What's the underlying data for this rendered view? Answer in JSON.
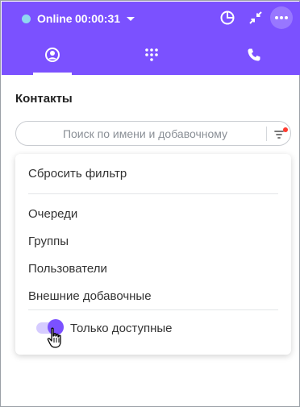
{
  "header": {
    "status": {
      "label": "Online",
      "time": "00:00:31",
      "dot_color": "#8fd8f0"
    },
    "accent_color": "#7b51ff",
    "icons": [
      "chart-pie-icon",
      "minimize-icon",
      "more-icon"
    ],
    "tabs": [
      {
        "name": "contacts",
        "icon": "user-circle-icon",
        "active": true
      },
      {
        "name": "dialpad",
        "icon": "dialpad-icon",
        "active": false
      },
      {
        "name": "calls",
        "icon": "phone-icon",
        "active": false
      }
    ]
  },
  "contacts": {
    "title": "Контакты",
    "search": {
      "placeholder": "Поиск по имени и добавочному",
      "value": ""
    },
    "filter_active": true
  },
  "filter_menu": {
    "reset_label": "Сбросить фильтр",
    "options": [
      "Очереди",
      "Группы",
      "Пользователи",
      "Внешние добавочные"
    ],
    "toggle": {
      "label": "Только доступные",
      "on": true
    }
  }
}
